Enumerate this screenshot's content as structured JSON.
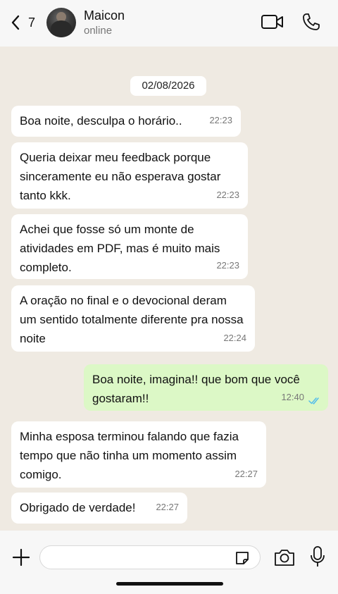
{
  "header": {
    "back_count": "7",
    "contact_name": "Maicon",
    "status": "online"
  },
  "chat": {
    "date": "02/08/2026",
    "messages": [
      {
        "dir": "in",
        "text": "Boa noite, desculpa o horário..",
        "time": "22:23"
      },
      {
        "dir": "in",
        "text": "Queria deixar meu feedback porque sinceramente eu não esperava gostar tanto kkk.",
        "time": "22:23"
      },
      {
        "dir": "in",
        "text": "Achei que fosse só um monte de atividades em PDF, mas é muito mais completo.",
        "time": "22:23"
      },
      {
        "dir": "in",
        "text": "A oração no final e o devocional deram um sentido totalmente diferente pra nossa noite",
        "time": "22:24"
      },
      {
        "dir": "out",
        "text": "Boa noite, imagina!! que bom que você gostaram!!",
        "time": "12:40",
        "read": true
      },
      {
        "dir": "in",
        "text": "Minha esposa terminou falando que fazia tempo que não tinha um momento assim comigo.",
        "time": "22:27"
      },
      {
        "dir": "in",
        "text": "Obrigado de verdade!",
        "time": "22:27"
      }
    ]
  },
  "input": {
    "value": ""
  },
  "colors": {
    "background": "#efeae2",
    "outgoing_bubble": "#dcf8c6",
    "incoming_bubble": "#ffffff",
    "read_ticks": "#53bdeb"
  },
  "icons": {
    "back": "chevron-left-icon",
    "video": "video-camera-icon",
    "call": "phone-icon",
    "plus": "plus-icon",
    "sticker": "sticker-icon",
    "camera": "camera-icon",
    "mic": "microphone-icon"
  }
}
